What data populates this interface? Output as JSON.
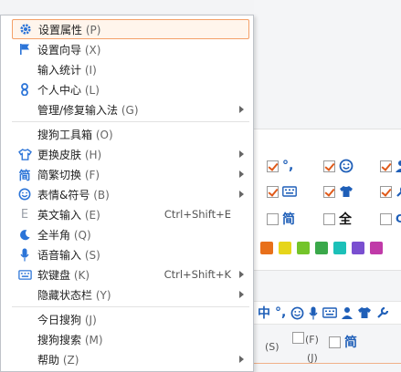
{
  "menu": {
    "items": [
      {
        "label": "设置属性",
        "key": "(P)"
      },
      {
        "label": "设置向导",
        "key": "(X)"
      },
      {
        "label": "输入统计",
        "key": "(I)"
      },
      {
        "label": "个人中心",
        "key": "(L)"
      },
      {
        "label": "管理/修复输入法",
        "key": "(G)"
      },
      {
        "label": "搜狗工具箱",
        "key": "(O)"
      },
      {
        "label": "更换皮肤",
        "key": "(H)"
      },
      {
        "label": "简繁切换",
        "key": "(F)"
      },
      {
        "label": "表情&符号",
        "key": "(B)"
      },
      {
        "label": "英文输入",
        "key": "(E)",
        "shortcut": "Ctrl+Shift+E"
      },
      {
        "label": "全半角",
        "key": "(Q)"
      },
      {
        "label": "语音输入",
        "key": "(S)"
      },
      {
        "label": "软键盘",
        "key": "(K)",
        "shortcut": "Ctrl+Shift+K"
      },
      {
        "label": "隐藏状态栏",
        "key": "(Y)"
      },
      {
        "label": "今日搜狗",
        "key": "(J)"
      },
      {
        "label": "搜狗搜索",
        "key": "(M)"
      },
      {
        "label": "帮助",
        "key": "(Z)"
      }
    ],
    "icon_glyphs": {
      "simplified": "简",
      "english": "E"
    }
  },
  "background": {
    "glyphs": {
      "punct": "°,",
      "simp": "简",
      "full": "全",
      "bar_zhong": "中",
      "bar_dot": "°,",
      "simp2": "简"
    },
    "swatch_colors": [
      "#e8701a",
      "#e6d51a",
      "#74c42a",
      "#3aa84a",
      "#1cc0b8",
      "#7a4fd0",
      "#c03aa8"
    ],
    "fragments": {
      "s": "(S)",
      "f": "(F)",
      "j": "(J)"
    }
  },
  "colors": {
    "accent": "#f4a068",
    "icon_blue": "#2b74d8",
    "check_orange": "#e05a1a"
  }
}
